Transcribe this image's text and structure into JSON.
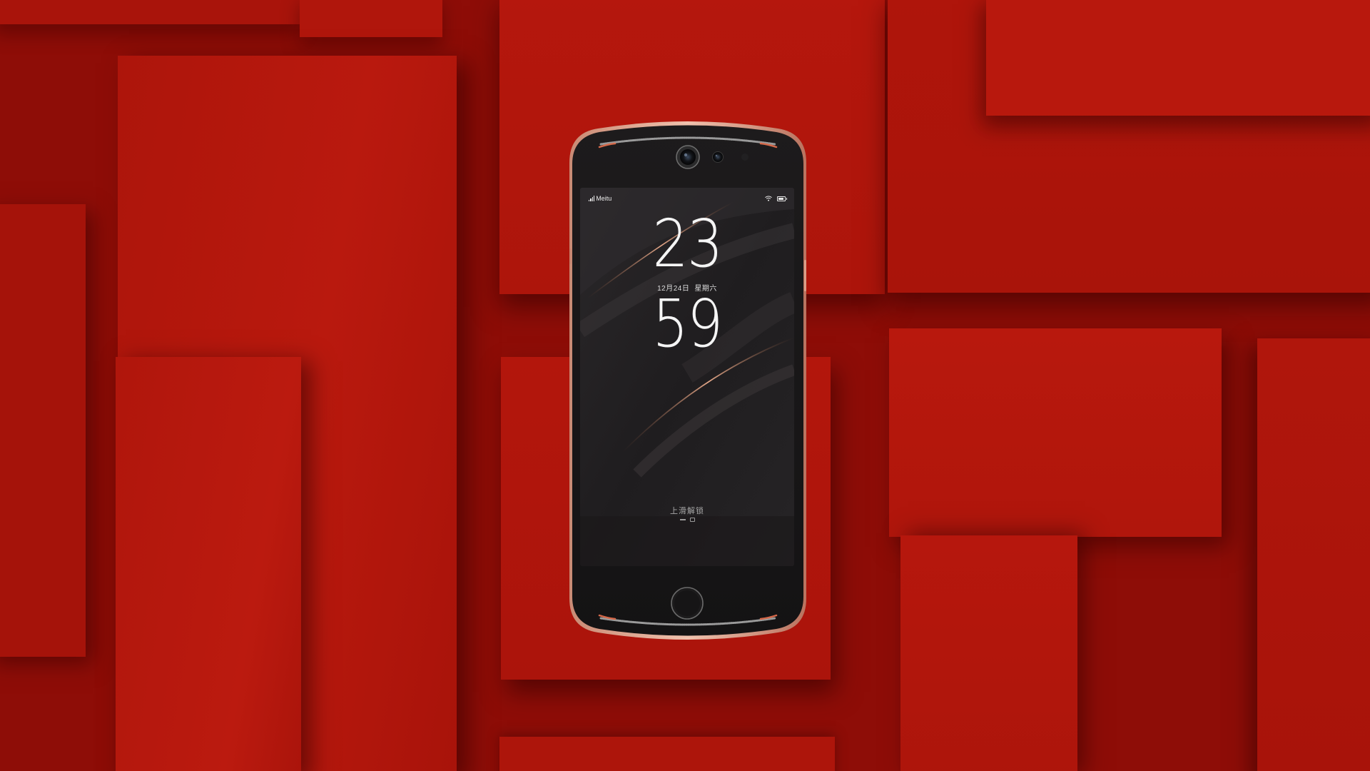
{
  "scene": {
    "background_color": "#8e0d07",
    "block_color": "#b3160c",
    "block_shadow_color": "#5e0502"
  },
  "phone": {
    "brand_color": "#d69a84",
    "status_bar": {
      "carrier": "Meitu",
      "icons": [
        "signal-icon",
        "wifi-icon",
        "battery-icon"
      ],
      "battery_level_fraction": 0.85
    },
    "clock": {
      "hour": "23",
      "minute": "59"
    },
    "date": {
      "date_text": "12月24日",
      "weekday": "星期六"
    },
    "unlock_hint": "上滑解锁",
    "bottom_icons": [
      "page-dash-icon",
      "camera-icon"
    ]
  }
}
